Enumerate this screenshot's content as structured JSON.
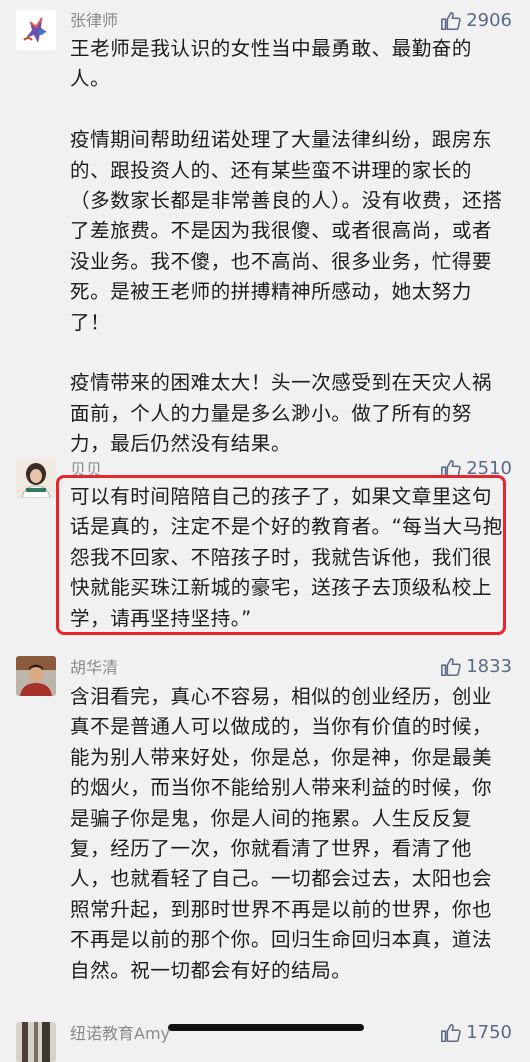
{
  "comments": [
    {
      "name": "张律师",
      "likes": "2906",
      "paragraphs": [
        "王老师是我认识的女性当中最勇敢、最勤奋的人。",
        "疫情期间帮助纽诺处理了大量法律纠纷，跟房东的、跟投资人的、还有某些蛮不讲理的家长的（多数家长都是非常善良的人）。没有收费，还搭了差旅费。不是因为我很傻、或者很高尚，或者没业务。我不傻，也不高尚、很多业务，忙得要死。是被王老师的拼搏精神所感动，她太努力了！",
        "疫情带来的困难太大！头一次感受到在天灾人祸面前，个人的力量是多么渺小。做了所有的努力，最后仍然没有结果。"
      ]
    },
    {
      "name": "贝贝",
      "likes": "2510",
      "paragraphs": [
        "可以有时间陪陪自己的孩子了，如果文章里这句话是真的，注定不是个好的教育者。“每当大马抱怨我不回家、不陪孩子时，我就告诉他，我们很快就能买珠江新城的豪宅，送孩子去顶级私校上学，请再坚持坚持。”"
      ]
    },
    {
      "name": "胡华清",
      "likes": "1833",
      "paragraphs": [
        "含泪看完，真心不容易，相似的创业经历，创业真不是普通人可以做成的，当你有价值的时候，能为别人带来好处，你是总，你是神，你是最美的烟火，而当你不能给别人带来利益的时候，你是骗子你是鬼，你是人间的拖累。人生反反复复，经历了一次，你就看清了世界，看清了他人，也就看轻了自己。一切都会过去，太阳也会照常升起，到那时世界不再是以前的世界，你也不再是以前的那个你。回归生命回归本真，道法自然。祝一切都会有好的结局。"
      ]
    },
    {
      "name": "纽诺教育Amy",
      "likes": "1750",
      "paragraphs": []
    }
  ],
  "colors": {
    "highlight": "#e8252d",
    "likes": "#5a6a86",
    "name": "#8a8a8a"
  },
  "icons": {
    "like": "thumbs-up-icon"
  }
}
